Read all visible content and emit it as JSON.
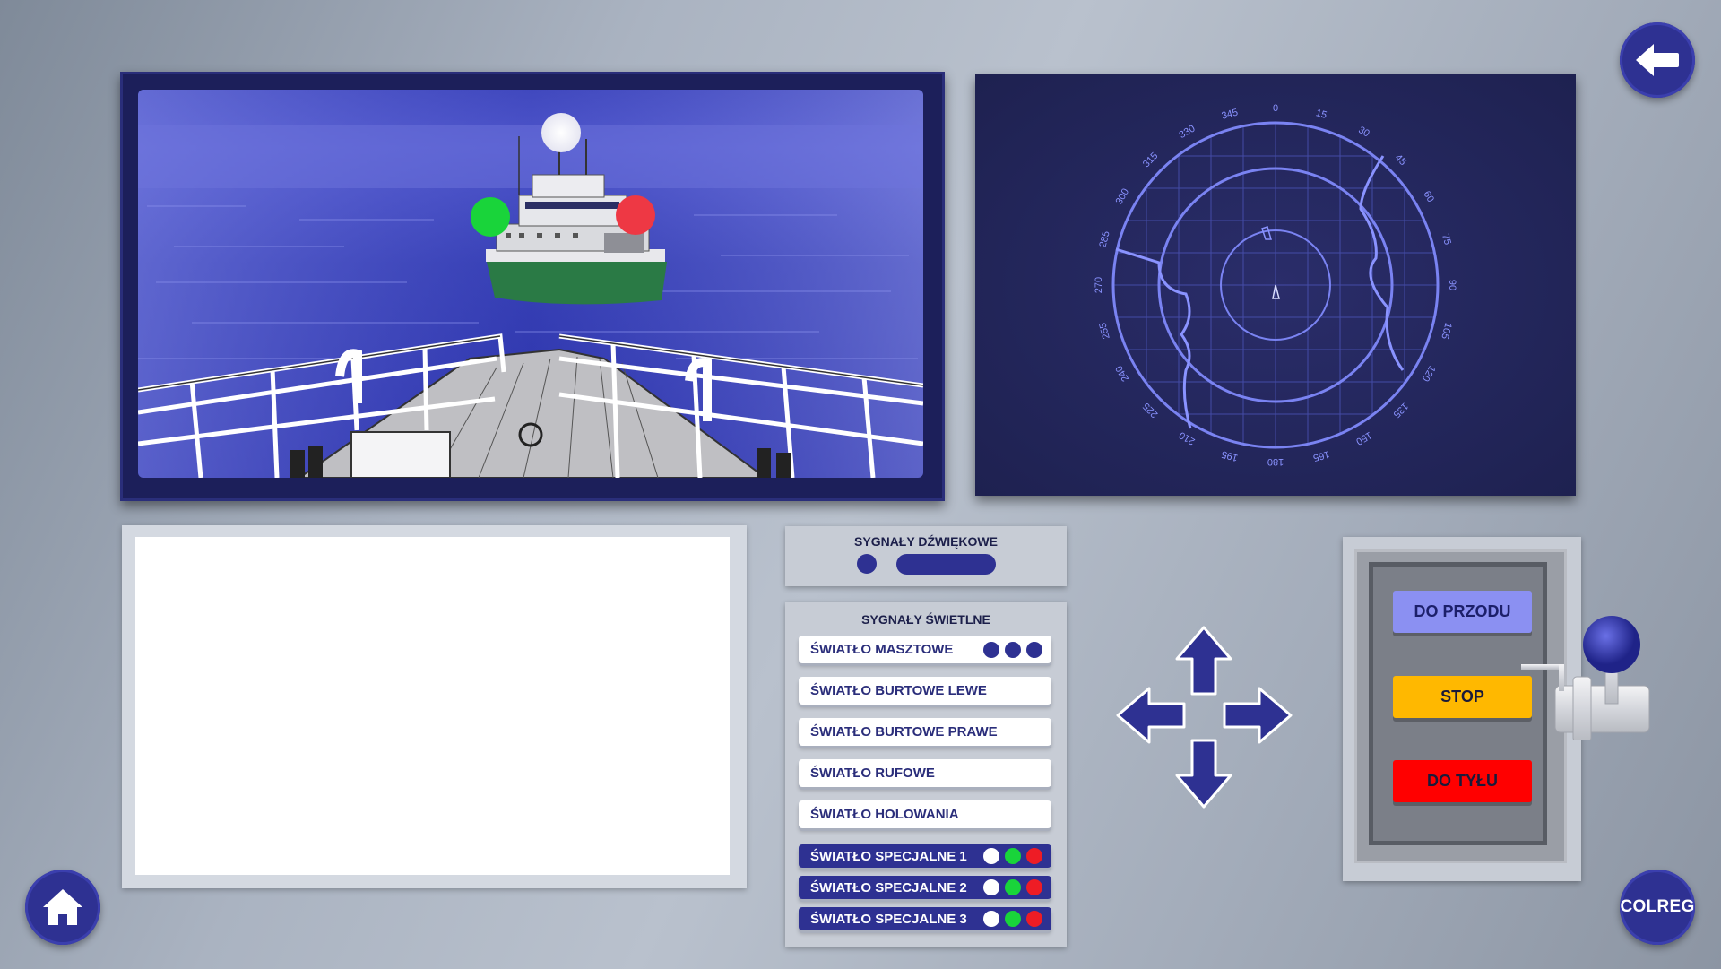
{
  "nav": {
    "back_icon": "arrow-left-icon",
    "home_icon": "home-icon",
    "colreg_label": "COLREG"
  },
  "camera": {
    "ship_lights": [
      "white-masthead-light",
      "green-starboard-light",
      "red-port-light"
    ]
  },
  "radar": {
    "bearing_labels": [
      "0",
      "15",
      "30",
      "45",
      "60",
      "75",
      "90",
      "105",
      "120",
      "135",
      "150",
      "165",
      "180",
      "195",
      "210",
      "225",
      "240",
      "255",
      "270",
      "285",
      "300",
      "315",
      "330",
      "345"
    ]
  },
  "sound_signals": {
    "title": "SYGNAŁY DŹWIĘKOWE"
  },
  "light_signals": {
    "title": "SYGNAŁY ŚWIETLNE",
    "masthead": "ŚWIATŁO MASZTOWE",
    "side_left": "ŚWIATŁO BURTOWE LEWE",
    "side_right": "ŚWIATŁO BURTOWE PRAWE",
    "stern": "ŚWIATŁO RUFOWE",
    "towing": "ŚWIATŁO HOLOWANIA",
    "special_1": "ŚWIATŁO SPECJALNE 1",
    "special_2": "ŚWIATŁO SPECJALNE 2",
    "special_3": "ŚWIATŁO SPECJALNE 3"
  },
  "telegraph": {
    "forward": "DO PRZODU",
    "stop": "STOP",
    "reverse": "DO TYŁU"
  },
  "colors": {
    "primary": "#2e3192",
    "forward": "#8b90f2",
    "stop": "#ffb800",
    "reverse": "#ff0000",
    "green": "#19d43a",
    "red": "#ee1c25"
  }
}
